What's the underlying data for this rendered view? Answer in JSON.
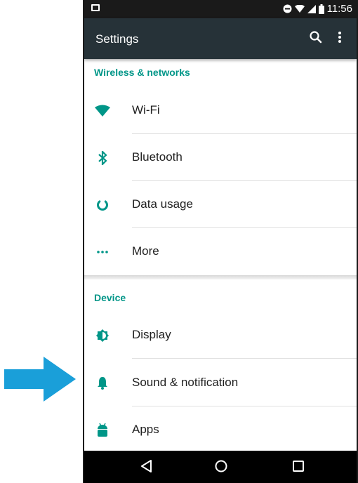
{
  "status_bar": {
    "time": "11:56",
    "icons": [
      "notification-icon",
      "do-not-disturb-icon",
      "wifi-icon",
      "signal-icon",
      "battery-icon"
    ]
  },
  "app_bar": {
    "title": "Settings",
    "actions": [
      "search-icon",
      "more-vert-icon"
    ]
  },
  "sections": [
    {
      "header": "Wireless & networks",
      "items": [
        {
          "label": "Wi-Fi",
          "icon": "wifi-icon"
        },
        {
          "label": "Bluetooth",
          "icon": "bluetooth-icon"
        },
        {
          "label": "Data usage",
          "icon": "data-usage-icon"
        },
        {
          "label": "More",
          "icon": "more-horiz-icon"
        }
      ]
    },
    {
      "header": "Device",
      "items": [
        {
          "label": "Display",
          "icon": "display-icon"
        },
        {
          "label": "Sound & notification",
          "icon": "bell-icon"
        },
        {
          "label": "Apps",
          "icon": "android-icon"
        }
      ]
    }
  ],
  "nav_bar": [
    "back-icon",
    "home-icon",
    "recents-icon"
  ],
  "colors": {
    "accent": "#009688",
    "app_bar": "#263238",
    "status_bar": "#1a1a1a",
    "pointer_arrow": "#1a9fd9"
  }
}
